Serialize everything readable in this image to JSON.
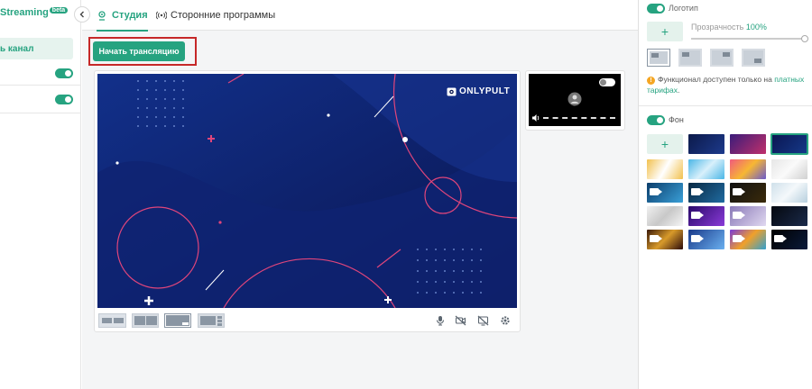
{
  "sidebar": {
    "brand": "Streaming",
    "brand_badge": "beta",
    "item_label": "ь канал",
    "toggles": [
      true,
      true
    ]
  },
  "tabs": [
    {
      "label": "Студия",
      "icon": "broadcast-icon",
      "active": true
    },
    {
      "label": "Сторонние программы",
      "icon": "radio-waves-icon",
      "active": false
    }
  ],
  "toolbar": {
    "start_label": "Начать трансляцию"
  },
  "preview": {
    "logo_text": "ONLYPULT"
  },
  "panel": {
    "logo_label": "Логотип",
    "logo_enabled": true,
    "add_label": "+",
    "opacity_label": "Прозрачность",
    "opacity_value": "100%",
    "notice_text": "Функционал доступен только на",
    "notice_link": "платных тарифах",
    "notice_end": ".",
    "bg_label": "Фон",
    "bg_enabled": true,
    "bg_add_label": "+"
  },
  "colors": {
    "accent": "#26a380",
    "highlight": "#c62828",
    "warning": "#f5a623",
    "canvas": "#0a1550",
    "pink": "#e0457b"
  }
}
